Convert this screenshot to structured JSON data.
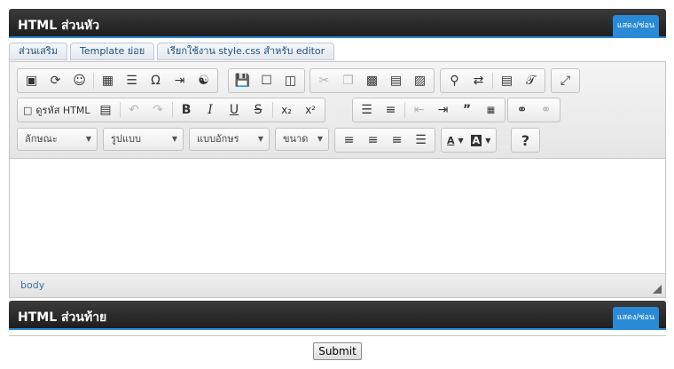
{
  "header_section": {
    "title": "HTML ส่วนหัว",
    "toggle_label": "แสดง/ซ่อน"
  },
  "tabs": [
    {
      "label": "ส่วนเสริม"
    },
    {
      "label": "Template ย่อย"
    },
    {
      "label": "เรียกใช้งาน style.css สำหรับ editor"
    }
  ],
  "toolbar": {
    "source_label": "ดูรหัส HTML",
    "format_combos": [
      {
        "label": "ลักษณะ"
      },
      {
        "label": "รูปแบบ"
      },
      {
        "label": "แบบอักษร"
      },
      {
        "label": "ขนาด"
      }
    ],
    "help_label": "?"
  },
  "status": {
    "path": "body"
  },
  "footer_section": {
    "title": "HTML ส่วนท้าย",
    "toggle_label": "แสดง/ซ่อน"
  },
  "submit": {
    "label": "Submit"
  }
}
